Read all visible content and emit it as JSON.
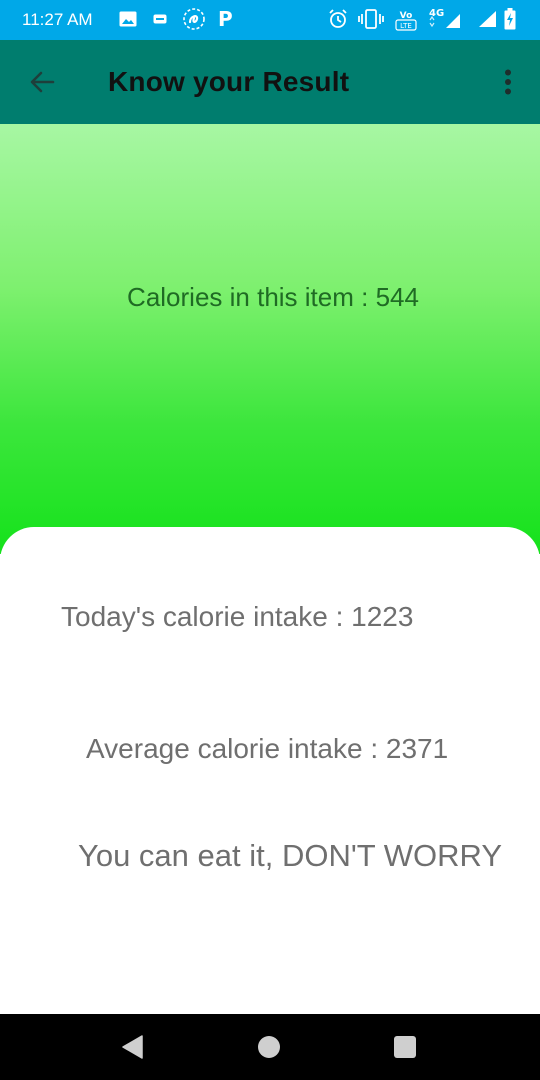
{
  "status_bar": {
    "time": "11:27 AM",
    "background_color": "#00a8e8",
    "icons": [
      "gallery-icon",
      "message-icon",
      "airtel-icon",
      "paytm-icon",
      "alarm-icon",
      "vibrate-icon",
      "volte-icon",
      "network-4g-icon",
      "signal-icon",
      "battery-charging-icon"
    ],
    "volte_label": "LTE",
    "network_label": "4G"
  },
  "app_bar": {
    "title": "Know your Result",
    "background_color": "#007d6e",
    "back_icon": "arrow-back-icon",
    "menu_icon": "more-vert-icon"
  },
  "result": {
    "calories_in_item": "Calories in this item : 544",
    "todays_intake": "Today's calorie intake : 1223",
    "average_intake": "Average calorie intake : 2371",
    "verdict": "You can eat it, DON'T WORRY",
    "header_gradient": [
      "#a7f7a3",
      "#15e21b"
    ]
  },
  "nav_bar": {
    "icons": [
      "nav-back-icon",
      "nav-home-icon",
      "nav-recents-icon"
    ]
  }
}
